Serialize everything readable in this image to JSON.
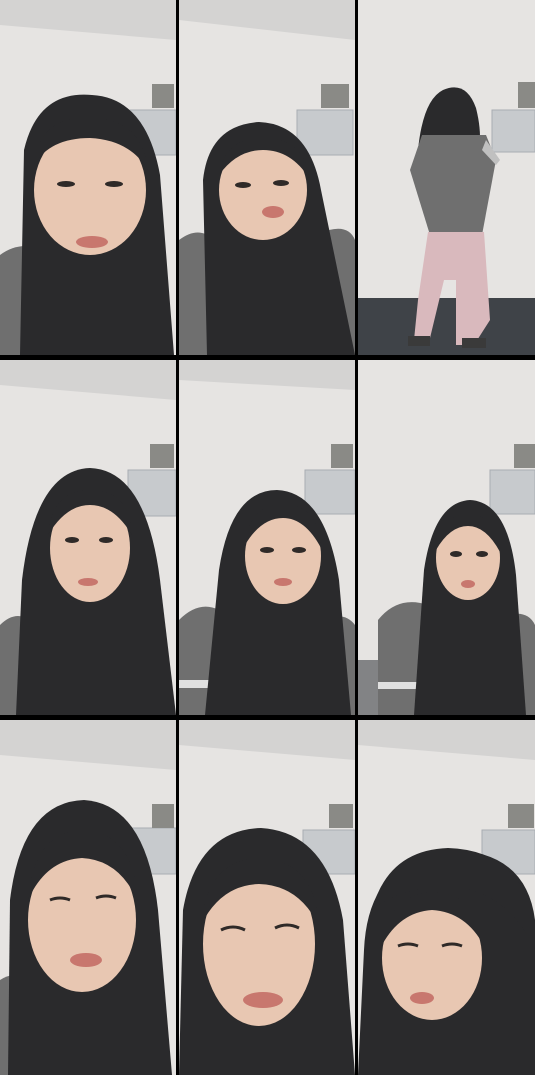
{
  "frames": [
    {
      "id": 1,
      "subject": "close-up"
    },
    {
      "id": 2,
      "subject": "close-up"
    },
    {
      "id": 3,
      "subject": "full-body-back"
    },
    {
      "id": 4,
      "subject": "close-up"
    },
    {
      "id": 5,
      "subject": "close-up"
    },
    {
      "id": 6,
      "subject": "close-up"
    },
    {
      "id": 7,
      "subject": "close-up"
    },
    {
      "id": 8,
      "subject": "close-up"
    },
    {
      "id": 9,
      "subject": "close-up"
    }
  ],
  "colors": {
    "divider": "#000000",
    "wall": "#e6e4e2",
    "ceiling": "#d4d3d2",
    "hijab": "#2a2a2c",
    "skin": "#e8c7b2",
    "lips": "#c8776e",
    "shirt": "#6f6f6f",
    "pants": "#d9b9bd",
    "floor": "#3f4348",
    "frame": "#c7cacd"
  }
}
